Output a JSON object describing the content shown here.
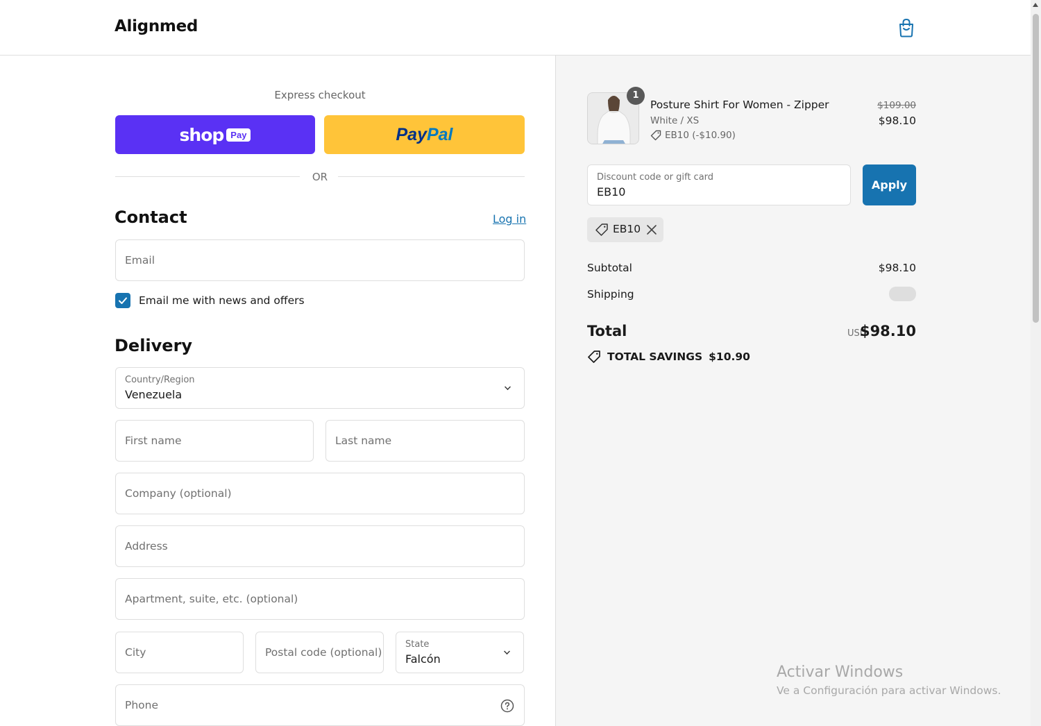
{
  "header": {
    "logo": "Alignmed",
    "cart_icon": "shopping-bag-icon"
  },
  "express": {
    "label": "Express checkout",
    "shop_pay": {
      "word": "shop",
      "pill": "Pay"
    },
    "paypal": {
      "part1": "Pay",
      "part2": "Pal"
    },
    "or_text": "OR"
  },
  "contact": {
    "title": "Contact",
    "login_label": "Log in",
    "email_placeholder": "Email",
    "newsletter_label": "Email me with news and offers",
    "newsletter_checked": true
  },
  "delivery": {
    "title": "Delivery",
    "country_label": "Country/Region",
    "country_value": "Venezuela",
    "first_name_placeholder": "First name",
    "last_name_placeholder": "Last name",
    "company_placeholder": "Company (optional)",
    "address_placeholder": "Address",
    "apartment_placeholder": "Apartment, suite, etc. (optional)",
    "city_placeholder": "City",
    "postal_placeholder": "Postal code (optional)",
    "state_label": "State",
    "state_value": "Falcón",
    "phone_placeholder": "Phone"
  },
  "summary": {
    "product": {
      "quantity": "1",
      "name": "Posture Shirt For Women - Zipper",
      "variant": "White / XS",
      "discount": "EB10 (-$10.90)",
      "original_price": "$109.00",
      "price": "$98.10"
    },
    "discount_field": {
      "label": "Discount code or gift card",
      "value": "EB10"
    },
    "apply_label": "Apply",
    "applied_code": "EB10",
    "subtotal_label": "Subtotal",
    "subtotal_value": "$98.10",
    "shipping_label": "Shipping",
    "total_label": "Total",
    "currency": "USD",
    "total_value": "$98.10",
    "savings_label": "TOTAL SAVINGS",
    "savings_value": "$10.90"
  },
  "watermark": {
    "title": "Activar Windows",
    "subtitle": "Ve a Configuración para activar Windows."
  },
  "colors": {
    "accent": "#1773b0",
    "shop_pay": "#5a31f4",
    "paypal": "#ffc439",
    "panel_bg": "#f5f5f5"
  }
}
